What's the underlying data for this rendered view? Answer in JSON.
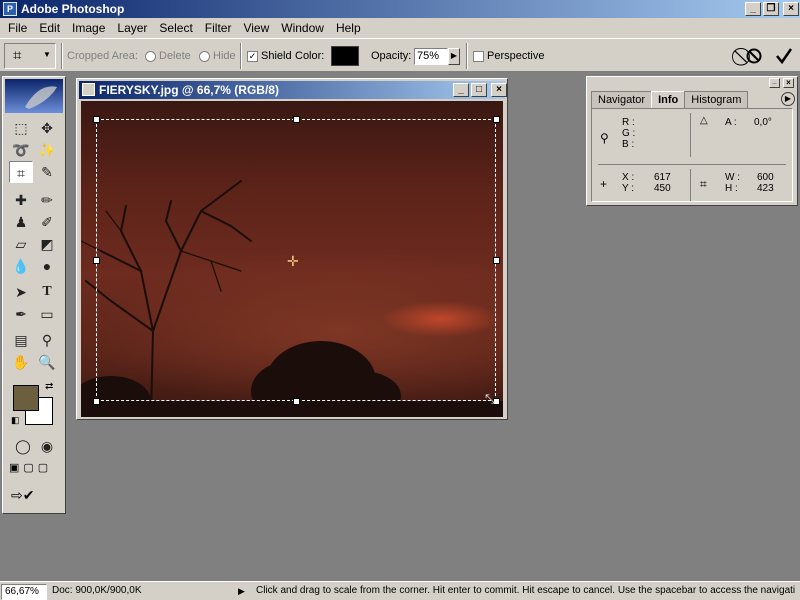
{
  "app": {
    "title": "Adobe Photoshop"
  },
  "menu": [
    "File",
    "Edit",
    "Image",
    "Layer",
    "Select",
    "Filter",
    "View",
    "Window",
    "Help"
  ],
  "options": {
    "cropped_area": "Cropped Area:",
    "delete": "Delete",
    "hide": "Hide",
    "shield": "Shield",
    "color": "Color:",
    "opacity_label": "Opacity:",
    "opacity_value": "75%",
    "perspective": "Perspective",
    "shield_color": "#000000"
  },
  "document": {
    "title": "FIERYSKY.jpg @ 66,7% (RGB/8)"
  },
  "colors": {
    "foreground": "#6b5f3f",
    "background": "#ffffff",
    "accent": "#0a246a"
  },
  "palette": {
    "tabs": [
      "Navigator",
      "Info",
      "Histogram"
    ],
    "active_tab": "Info",
    "r_label": "R :",
    "g_label": "G :",
    "b_label": "B :",
    "a_label": "A :",
    "a_value": "0,0°",
    "x_label": "X :",
    "x_value": "617",
    "y_label": "Y :",
    "y_value": "450",
    "w_label": "W :",
    "w_value": "600",
    "h_label": "H :",
    "h_value": "423"
  },
  "status": {
    "zoom": "66,67%",
    "doc": "Doc: 900,0K/900,0K",
    "message": "Click and drag to scale from the corner. Hit enter to commit. Hit escape to cancel. Use the spacebar to access the navigati"
  }
}
